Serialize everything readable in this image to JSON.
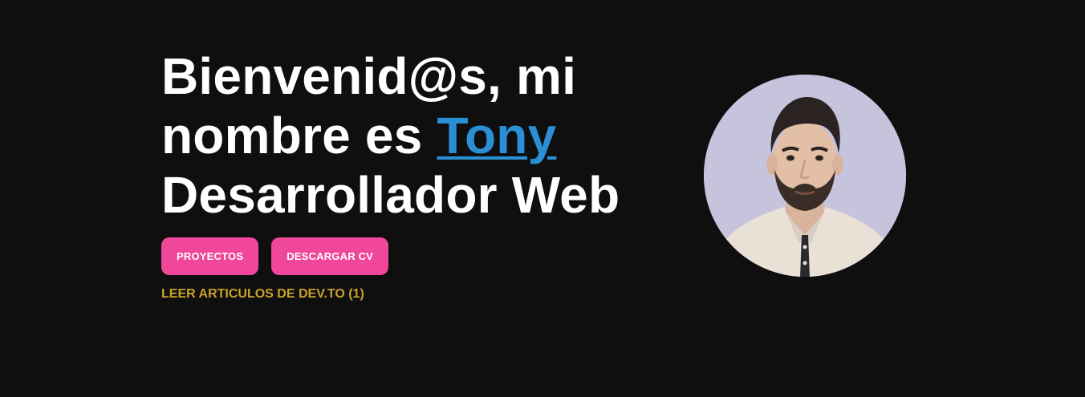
{
  "hero": {
    "greeting_line1": "Bienvenid@s, mi",
    "greeting_prefix": "nombre es ",
    "name": "Tony",
    "role": "Desarrollador Web"
  },
  "buttons": {
    "projects_label": "PROYECTOS",
    "download_cv_label": "DESCARGAR CV"
  },
  "articles_link": {
    "label": "LEER ARTICULOS DE DEV.TO (1)"
  },
  "colors": {
    "background": "#0f0f10",
    "heading_text": "#ffffff",
    "name_link": "#2b8fd6",
    "button_bg": "#f0479b",
    "articles_link": "#c9a227",
    "avatar_bg": "#c6c3dd"
  },
  "avatar": {
    "icon": "profile-photo"
  }
}
